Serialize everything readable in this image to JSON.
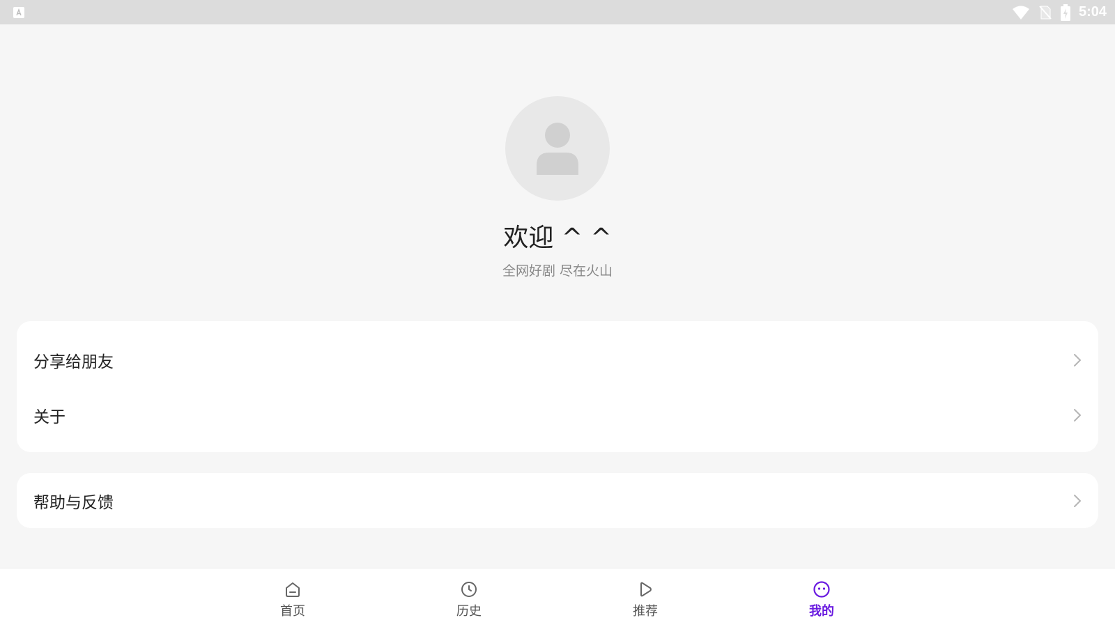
{
  "status_bar": {
    "time": "5:04",
    "left_icon": "keyboard-icon",
    "right_icons": [
      "wifi-icon",
      "no-sim-icon",
      "battery-charging-icon"
    ]
  },
  "profile": {
    "avatar_icon": "default-user-icon",
    "welcome": "欢迎 ^ ^",
    "slogan": "全网好剧 尽在火山"
  },
  "menu": {
    "group1": [
      {
        "label": "分享给朋友",
        "icon": "chevron-right-icon"
      },
      {
        "label": "关于",
        "icon": "chevron-right-icon"
      }
    ],
    "group2": [
      {
        "label": "帮助与反馈",
        "icon": "chevron-right-icon"
      }
    ]
  },
  "bottom_nav": {
    "active_color": "#6a1be0",
    "items": [
      {
        "label": "首页",
        "icon": "home-icon",
        "active": false
      },
      {
        "label": "历史",
        "icon": "clock-icon",
        "active": false
      },
      {
        "label": "推荐",
        "icon": "play-icon",
        "active": false
      },
      {
        "label": "我的",
        "icon": "smiley-icon",
        "active": true
      }
    ]
  }
}
